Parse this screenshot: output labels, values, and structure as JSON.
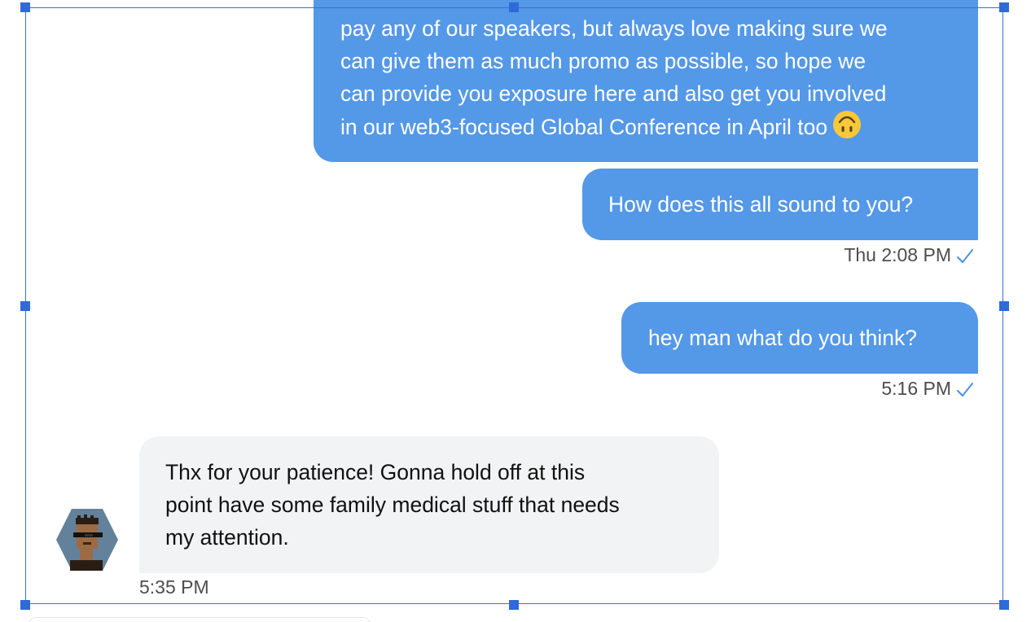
{
  "messages": {
    "sent_1": {
      "lines": [
        "pay any of our speakers, but always love making sure we",
        "can give them as much promo as possible, so hope we",
        "can provide you exposure here and also get you involved",
        "in our web3-focused Global Conference in April too"
      ],
      "emoji": "upside-down-face-emoji"
    },
    "sent_2": {
      "text": "How does this all sound to you?",
      "timestamp": "Thu 2:08 PM"
    },
    "sent_3": {
      "text": "hey man what do you think?",
      "timestamp": "5:16 PM"
    },
    "received_1": {
      "lines": [
        "Thx for your patience! Gonna hold off at this",
        "point have some family medical stuff that needs",
        "my attention."
      ],
      "timestamp": "5:35 PM"
    }
  },
  "colors": {
    "sent_bubble": "#5498e8",
    "received_bubble": "#f2f3f4",
    "selection": "#2f6ad9",
    "read_check": "#4a90e2"
  },
  "icons": {
    "read_receipt": "checkmark-icon",
    "avatar": "pixel-punk-avatar"
  }
}
